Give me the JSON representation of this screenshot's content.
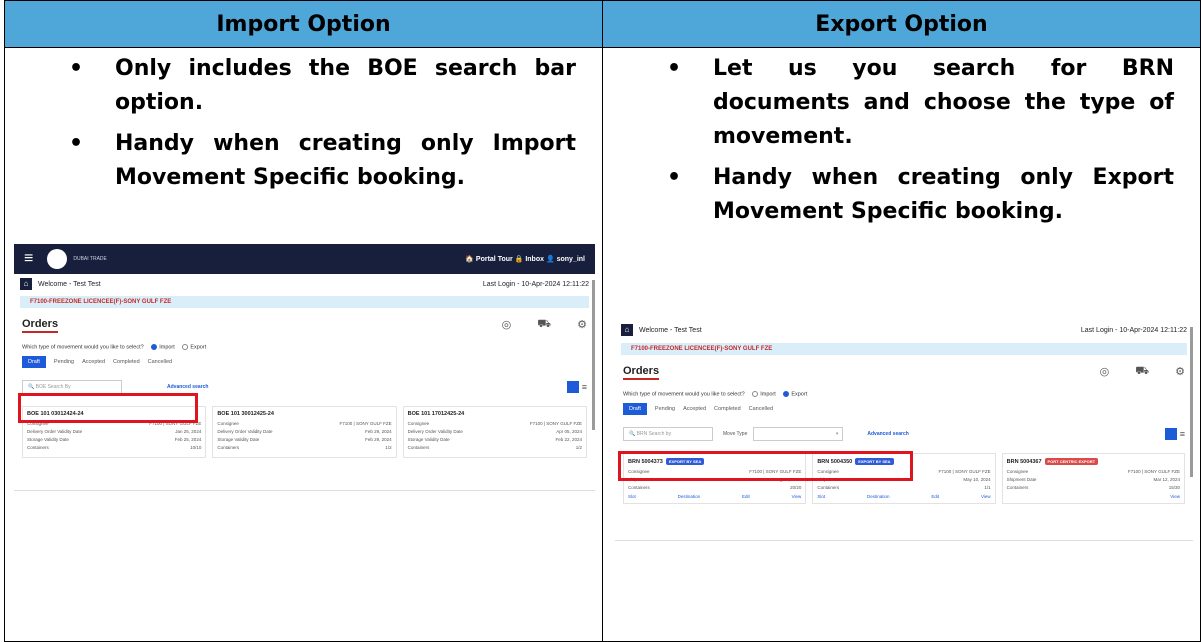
{
  "table": {
    "import_header": "Import Option",
    "export_header": "Export Option",
    "import_bullets": [
      "Only includes the BOE search bar option.",
      "Handy when creating only Import Movement Specific booking."
    ],
    "export_bullets": [
      "Let us you search for BRN documents and choose the type of movement.",
      "Handy when creating only Export Movement Specific booking."
    ]
  },
  "import_shot": {
    "topbar_right": "🏠 Portal Tour  🔒 Inbox  👤 sony_inl",
    "logo_text": "DUBAI TRADE",
    "welcome": "Welcome - Test Test",
    "last_login": "Last Login - 10-Apr-2024 12:11:22",
    "company": "F7100-FREEZONE LICENCEE(F)-SONY GULF FZE",
    "orders_title": "Orders",
    "movement_q": "Which type of movement would you like to select?",
    "import_opt": "Import",
    "export_opt": "Export",
    "tabs": [
      "Draft",
      "Pending",
      "Accepted",
      "Completed",
      "Cancelled"
    ],
    "search_placeholder": "BOE Search By",
    "advanced_search": "Advanced search",
    "cards": [
      {
        "title": "BOE 101 03012424-24",
        "consignee": "F7100 | SONY GULF FZE",
        "date": "Jan 25, 2024",
        "storage": "Feb 25, 2024",
        "containers": "10/10"
      },
      {
        "title": "BOE 101 30012425-24",
        "consignee": "F7100 | SONY GULF FZE",
        "date": "Feb 29, 2024",
        "storage": "Feb 29, 2024",
        "containers": "1/2"
      },
      {
        "title": "BOE 101 17012425-24",
        "consignee": "F7100 | SONY GULF FZE",
        "date": "Apr 05, 2024",
        "storage": "Feb 22, 2024",
        "containers": "1/2"
      }
    ],
    "labels": {
      "consignee": "Consignee",
      "delivery": "Delivery Order Validity Date",
      "storage": "Storage Validity Date",
      "containers": "Containers"
    }
  },
  "export_shot": {
    "welcome": "Welcome - Test Test",
    "last_login": "Last Login - 10-Apr-2024 12:11:22",
    "company": "F7100-FREEZONE LICENCEE(F)-SONY GULF FZE",
    "orders_title": "Orders",
    "movement_q": "Which type of movement would you like to select?",
    "import_opt": "Import",
    "export_opt": "Export",
    "tabs": [
      "Draft",
      "Pending",
      "Accepted",
      "Completed",
      "Cancelled"
    ],
    "search_placeholder": "BRN Search by",
    "move_type": "Move Type",
    "advanced_search": "Advanced search",
    "cards": [
      {
        "title": "BRN 5004373",
        "tag": "EXPORT BY SEA",
        "consignee": "F7100 | SONY GULF FZE",
        "date": "Aug 28, 2024",
        "containers": "20/20",
        "footer": [
          "Slot",
          "Destination",
          "Edit",
          "View"
        ]
      },
      {
        "title": "BRN 5004350",
        "tag": "EXPORT BY SEA",
        "consignee": "F7100 | SONY GULF FZE",
        "date": "May 10, 2024",
        "containers": "1/1",
        "footer": [
          "Slot",
          "Destination",
          "Edit",
          "View"
        ]
      },
      {
        "title": "BRN 5004367",
        "tag": "PORT CENTRIC EXPORT",
        "consignee": "F7100 | SONY GULF FZE",
        "date": "Mar 12, 2024",
        "containers": "15/30",
        "footer": [
          "View"
        ]
      }
    ],
    "labels": {
      "consignee": "Consignee",
      "date": "Shipment Date",
      "containers": "Containers"
    }
  }
}
